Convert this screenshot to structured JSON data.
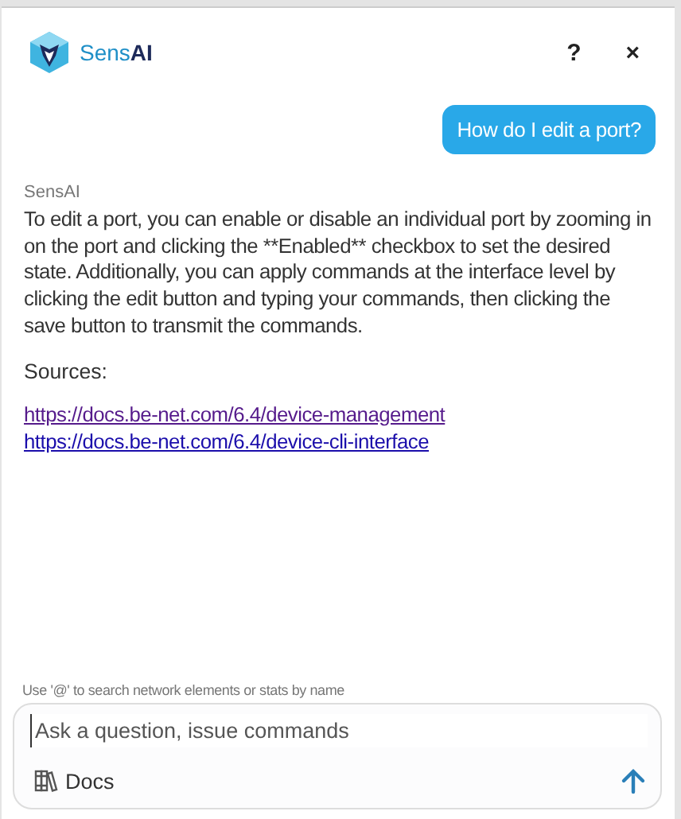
{
  "header": {
    "brand": "Sens**AI**",
    "help": "?",
    "close": "×"
  },
  "messages": [
    {
      "kind": "user",
      "text": "How do I edit a port?"
    },
    {
      "kind": "assistant",
      "sender": "SensAI",
      "text": "To edit a port, you can enable or disable an individual port by zooming in on the port and clicking the **Enabled** checkbox to set the desired state. Additionally, you can apply commands at the interface level by clicking the edit button and typing your commands, then clicking the save button to transmit the commands.",
      "sources_label": "Sources:",
      "links": [
        "https://docs.be-net.com/6.4/device-management",
        "https://docs.be-net.com/6.4/device-cli-interface"
      ]
    }
  ],
  "composer": {
    "hint": "Use '@' to search network elements or stats by name",
    "placeholder": "Ask a question, issue commands",
    "docs": "Docs"
  }
}
